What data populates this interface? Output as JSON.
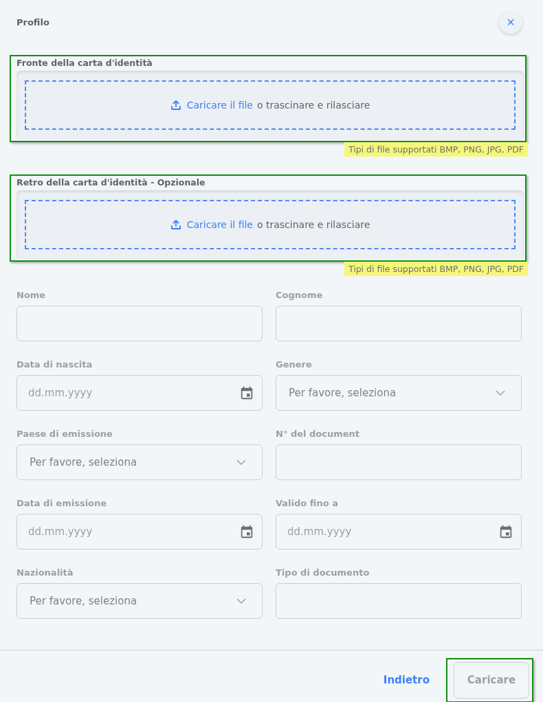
{
  "header": {
    "title": "Profilo",
    "close": "×"
  },
  "uploads": [
    {
      "label": "Fronte della carta d'identità",
      "link": "Caricare il file",
      "rest": "o trascinare e rilasciare",
      "hint": "Tipi di file supportati BMP, PNG, JPG, PDF",
      "highlighted": true
    },
    {
      "label": "Retro della carta d'identità - Opzionale",
      "link": "Caricare il file",
      "rest": "o trascinare e rilasciare",
      "hint": "Tipi di file supportati BMP, PNG, JPG, PDF",
      "highlighted": true
    }
  ],
  "fields": [
    {
      "label": "Nome",
      "kind": "text"
    },
    {
      "label": "Cognome",
      "kind": "text"
    },
    {
      "label": "Data di nascita",
      "kind": "date",
      "placeholder": "dd.mm.yyyy"
    },
    {
      "label": "Genere",
      "kind": "select",
      "value": "Per favore, seleziona"
    },
    {
      "label": "Paese di emissione",
      "kind": "select",
      "value": "Per favore, seleziona"
    },
    {
      "label": "N° del document",
      "kind": "text"
    },
    {
      "label": "Data di emissione",
      "kind": "date",
      "placeholder": "dd.mm.yyyy"
    },
    {
      "label": "Valido fino a",
      "kind": "date",
      "placeholder": "dd.mm.yyyy"
    },
    {
      "label": "Nazionalità",
      "kind": "select",
      "value": "Per favore, seleziona"
    },
    {
      "label": "Tipo di documento",
      "kind": "text"
    }
  ],
  "footer": {
    "back": "Indietro",
    "submit": {
      "label": "Caricare",
      "disabled": true,
      "highlighted": true
    }
  }
}
